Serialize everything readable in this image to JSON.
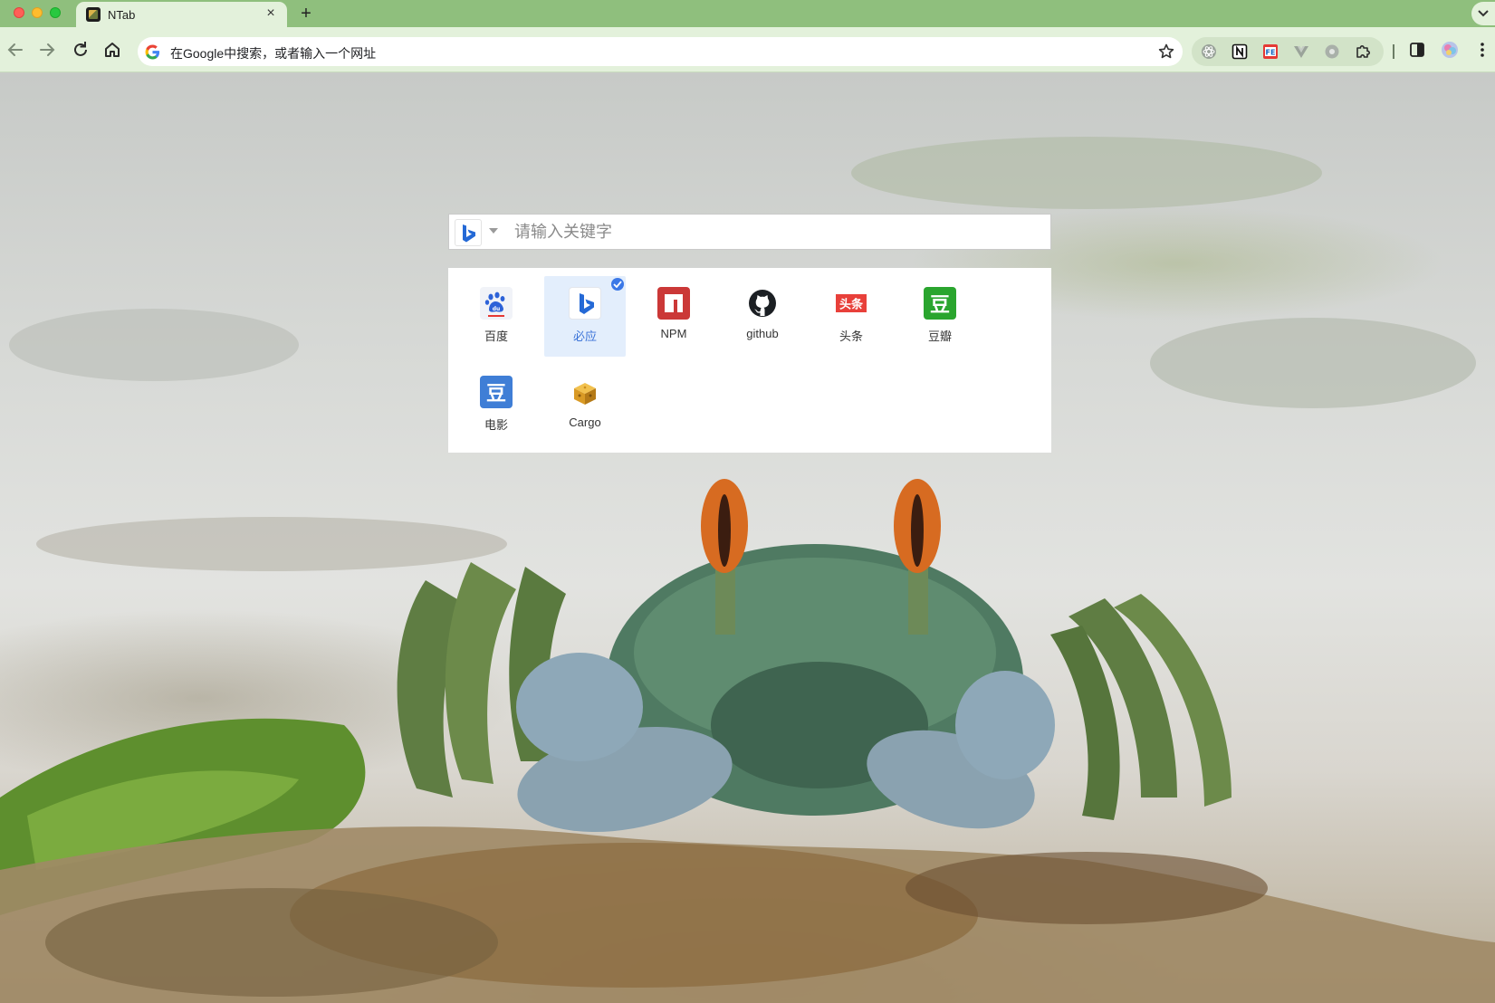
{
  "browser": {
    "tab": {
      "title": "NTab",
      "close_glyph": "×",
      "favicon": "ntab-favicon"
    },
    "new_tab_glyph": "+",
    "address_bar": {
      "placeholder": "在Google中搜索，或者输入一个网址"
    },
    "accent_color": "#8fbf7d",
    "toolbar_color": "#e3f1db"
  },
  "search": {
    "engine": "bing-icon",
    "placeholder": "请输入关键字"
  },
  "sites": [
    {
      "label": "百度",
      "icon": "baidu-icon",
      "selected": false
    },
    {
      "label": "必应",
      "icon": "bing-icon",
      "selected": true
    },
    {
      "label": "NPM",
      "icon": "npm-icon",
      "selected": false
    },
    {
      "label": "github",
      "icon": "github-icon",
      "selected": false
    },
    {
      "label": "头条",
      "icon": "toutiao-icon",
      "icon_text": "头条",
      "selected": false
    },
    {
      "label": "豆瓣",
      "icon": "douban-icon",
      "icon_text": "豆",
      "selected": false
    },
    {
      "label": "电影",
      "icon": "douban-movie-icon",
      "icon_text": "豆",
      "selected": false
    },
    {
      "label": "Cargo",
      "icon": "cargo-icon",
      "selected": false
    }
  ],
  "colors": {
    "selected_bg": "#e3eefc",
    "selected_text": "#3b73d8",
    "npm": "#cb3837",
    "douban": "#2aa52e",
    "douban_movie": "#3f7ed6",
    "toutiao": "#e8403a"
  }
}
